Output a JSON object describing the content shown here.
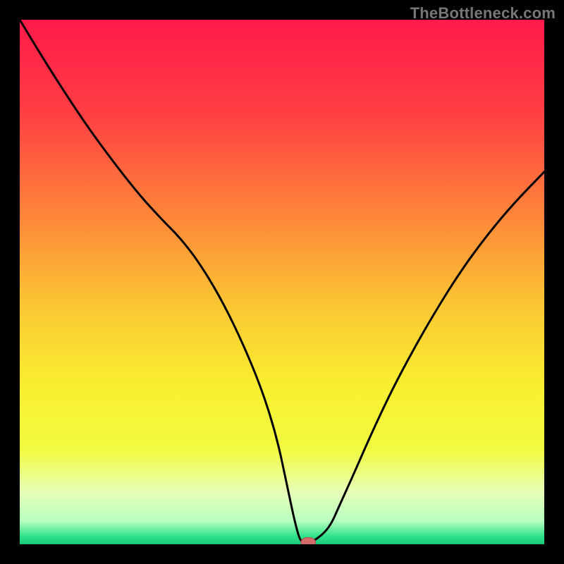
{
  "watermark": "TheBottleneck.com",
  "chart_data": {
    "type": "line",
    "title": "",
    "xlabel": "",
    "ylabel": "",
    "xlim": [
      0,
      100
    ],
    "ylim": [
      0,
      100
    ],
    "grid": false,
    "legend": false,
    "background_gradient_stops": [
      {
        "offset": 0.0,
        "color": "#ff1a4a"
      },
      {
        "offset": 0.18,
        "color": "#ff3f43"
      },
      {
        "offset": 0.36,
        "color": "#fd813a"
      },
      {
        "offset": 0.55,
        "color": "#fbc833"
      },
      {
        "offset": 0.7,
        "color": "#f9ef30"
      },
      {
        "offset": 0.82,
        "color": "#f1fb41"
      },
      {
        "offset": 0.9,
        "color": "#e7ffb8"
      },
      {
        "offset": 0.955,
        "color": "#b8ffc0"
      },
      {
        "offset": 0.985,
        "color": "#2fe28a"
      },
      {
        "offset": 1.0,
        "color": "#18c979"
      }
    ],
    "series": [
      {
        "name": "bottleneck-curve",
        "color": "#000000",
        "stroke_width": 3,
        "x": [
          0.0,
          3.0,
          8.0,
          14.0,
          22.0,
          27.0,
          30.5,
          34.0,
          38.0,
          42.0,
          46.0,
          49.0,
          51.0,
          52.5,
          53.5,
          54.5,
          56.0,
          59.0,
          61.0,
          63.5,
          67.0,
          71.0,
          75.0,
          79.0,
          84.0,
          89.0,
          94.0,
          100.0
        ],
        "y": [
          100.0,
          95.0,
          87.0,
          78.0,
          67.5,
          62.0,
          58.5,
          54.0,
          47.5,
          39.5,
          30.0,
          20.5,
          11.0,
          4.0,
          0.5,
          0.3,
          0.5,
          3.0,
          7.5,
          13.0,
          21.0,
          29.5,
          37.0,
          44.0,
          52.0,
          58.8,
          64.8,
          71.0
        ]
      }
    ],
    "marker": {
      "name": "optimum-marker",
      "x": 55.0,
      "y": 0.4,
      "rx": 1.4,
      "ry": 0.9,
      "fill": "#d56a6a",
      "stroke": "#b44e4e"
    }
  }
}
